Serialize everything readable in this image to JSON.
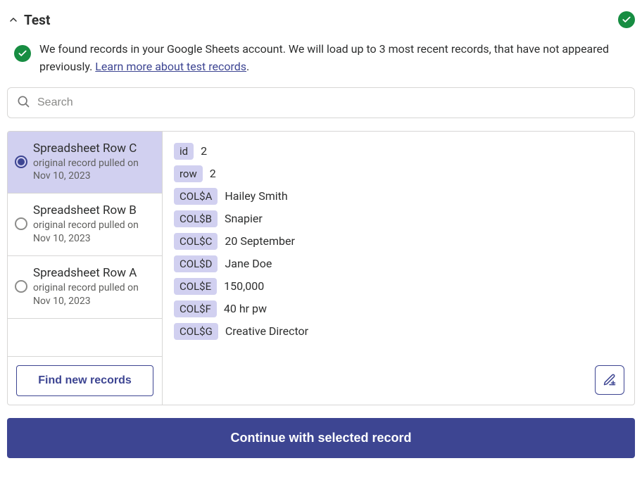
{
  "header": {
    "title": "Test"
  },
  "banner": {
    "text_before_link": "We found records in your Google Sheets account. We will load up to 3 most recent records, that have not appeared previously. ",
    "link_text": "Learn more about test records",
    "text_after_link": "."
  },
  "search": {
    "placeholder": "Search",
    "value": ""
  },
  "records": [
    {
      "title": "Spreadsheet Row C",
      "subtitle": "original record pulled on Nov 10, 2023",
      "selected": true
    },
    {
      "title": "Spreadsheet Row B",
      "subtitle": "original record pulled on Nov 10, 2023",
      "selected": false
    },
    {
      "title": "Spreadsheet Row A",
      "subtitle": "original record pulled on Nov 10, 2023",
      "selected": false
    }
  ],
  "fields": [
    {
      "key": "id",
      "value": "2"
    },
    {
      "key": "row",
      "value": "2"
    },
    {
      "key": "COL$A",
      "value": "Hailey Smith"
    },
    {
      "key": "COL$B",
      "value": "Snapier"
    },
    {
      "key": "COL$C",
      "value": "20 September"
    },
    {
      "key": "COL$D",
      "value": "Jane Doe"
    },
    {
      "key": "COL$E",
      "value": "150,000"
    },
    {
      "key": "COL$F",
      "value": "40 hr pw"
    },
    {
      "key": "COL$G",
      "value": "Creative Director"
    }
  ],
  "actions": {
    "find_new_records": "Find new records",
    "continue": "Continue with selected record"
  }
}
